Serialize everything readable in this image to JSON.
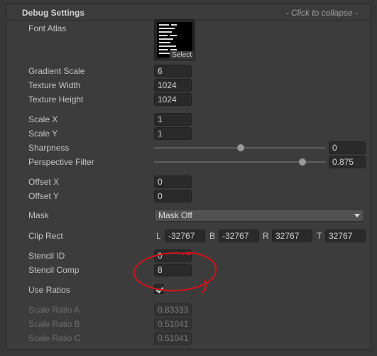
{
  "header": {
    "title": "Debug Settings",
    "collapse_hint": "- Click to collapse -"
  },
  "font_atlas": {
    "label": "Font Atlas",
    "select_label": "Select"
  },
  "gradient_scale": {
    "label": "Gradient Scale",
    "value": "6"
  },
  "texture_width": {
    "label": "Texture Width",
    "value": "1024"
  },
  "texture_height": {
    "label": "Texture Height",
    "value": "1024"
  },
  "scale_x": {
    "label": "Scale X",
    "value": "1"
  },
  "scale_y": {
    "label": "Scale Y",
    "value": "1"
  },
  "sharpness": {
    "label": "Sharpness",
    "value": "0"
  },
  "perspective_filter": {
    "label": "Perspective Filter",
    "value": "0.875"
  },
  "offset_x": {
    "label": "Offset X",
    "value": "0"
  },
  "offset_y": {
    "label": "Offset Y",
    "value": "0"
  },
  "mask": {
    "label": "Mask",
    "selected": "Mask Off"
  },
  "clip_rect": {
    "label": "Clip Rect",
    "l_label": "L",
    "l_value": "-32767",
    "b_label": "B",
    "b_value": "-32767",
    "r_label": "R",
    "r_value": "32767",
    "t_label": "T",
    "t_value": "32767"
  },
  "stencil_id": {
    "label": "Stencil ID",
    "value": "0"
  },
  "stencil_comp": {
    "label": "Stencil Comp",
    "value": "8"
  },
  "use_ratios": {
    "label": "Use Ratios",
    "checked": true
  },
  "scale_ratio_a": {
    "label": "Scale Ratio A",
    "value": "0.83333"
  },
  "scale_ratio_b": {
    "label": "Scale Ratio B",
    "value": "0.51041"
  },
  "scale_ratio_c": {
    "label": "Scale Ratio C",
    "value": "0.51041"
  },
  "colors": {
    "annotation": "#c8161d"
  }
}
